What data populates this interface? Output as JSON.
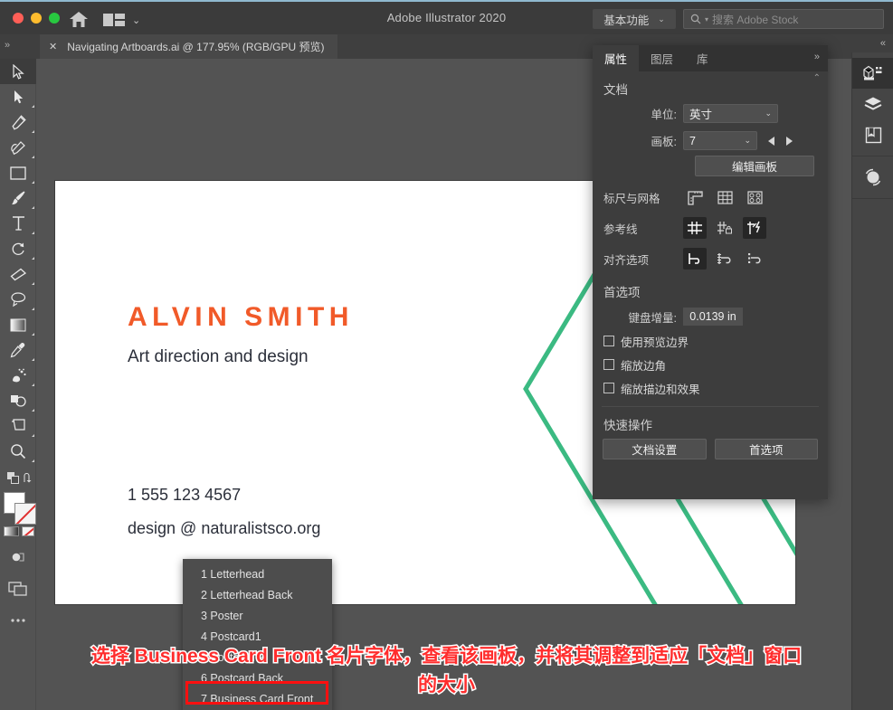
{
  "window": {
    "app_title": "Adobe Illustrator 2020",
    "traffic_lights": [
      "close",
      "minimize",
      "maximize"
    ],
    "home_icon": "home-icon",
    "workspace_switch_icon": "layout-switch-icon",
    "workspace_menu": {
      "label": "基本功能",
      "caret": "⌄"
    },
    "stock_search": {
      "placeholder": "搜索 Adobe Stock",
      "icon": "search-icon"
    }
  },
  "tabbar": {
    "overflow_left": "»",
    "overflow_right": "«",
    "tab": {
      "close": "✕",
      "title": "Navigating Artboards.ai @ 177.95% (RGB/GPU 预览)"
    }
  },
  "toolbar": {
    "tools": [
      {
        "name": "selection-tool",
        "active": true,
        "has_flyout": false
      },
      {
        "name": "direct-selection-tool",
        "active": false,
        "has_flyout": true
      },
      {
        "name": "pen-tool",
        "active": false,
        "has_flyout": true
      },
      {
        "name": "curvature-tool",
        "active": false,
        "has_flyout": true
      },
      {
        "name": "rectangle-tool",
        "active": false,
        "has_flyout": true
      },
      {
        "name": "paintbrush-tool",
        "active": false,
        "has_flyout": true
      },
      {
        "name": "type-tool",
        "active": false,
        "has_flyout": true
      },
      {
        "name": "rotate-tool",
        "active": false,
        "has_flyout": true
      },
      {
        "name": "eraser-tool",
        "active": false,
        "has_flyout": true
      },
      {
        "name": "lasso-tool",
        "active": false,
        "has_flyout": true
      },
      {
        "name": "gradient-tool",
        "active": false,
        "has_flyout": true
      },
      {
        "name": "eyedropper-tool",
        "active": false,
        "has_flyout": true
      },
      {
        "name": "symbol-sprayer-tool",
        "active": false,
        "has_flyout": true
      },
      {
        "name": "shape-builder-tool",
        "active": false,
        "has_flyout": true
      },
      {
        "name": "artboard-tool",
        "active": false,
        "has_flyout": true
      },
      {
        "name": "zoom-tool",
        "active": false,
        "has_flyout": true
      }
    ],
    "swap_fill_stroke_icon": "swap-fill-stroke-icon",
    "default_fill_stroke_icon": "default-fill-stroke-icon",
    "fill_color": "#ffffff",
    "stroke_color": "none",
    "color_mode_icons": [
      "gradient-icon",
      "none-icon"
    ],
    "draw_mode_icon": "draw-normal-icon",
    "screen_mode_icon": "screen-mode-icon",
    "more_tools_icon": "more-tools-icon"
  },
  "artwork": {
    "name": "ALVIN SMITH",
    "name_color": "#f15a29",
    "subtitle": "Art direction and design",
    "phone": "1 555 123 4567",
    "email": "design @ naturalistsco.org",
    "accent_green": "#3bba82",
    "chevron_count": 3
  },
  "artboard_dropdown": {
    "items": [
      {
        "index": 1,
        "label": "1 Letterhead",
        "selected": false
      },
      {
        "index": 2,
        "label": "2 Letterhead Back",
        "selected": false
      },
      {
        "index": 3,
        "label": "3 Poster",
        "selected": false
      },
      {
        "index": 4,
        "label": "4 Postcard1",
        "selected": false
      },
      {
        "index": 5,
        "label": "5 Postcard 2",
        "selected": false
      },
      {
        "index": 6,
        "label": "6 Postcard Back",
        "selected": false
      },
      {
        "index": 7,
        "label": "7 Business Card Front",
        "selected": true
      }
    ]
  },
  "properties": {
    "tabs": [
      {
        "label": "属性",
        "active": true
      },
      {
        "label": "图层",
        "active": false
      },
      {
        "label": "库",
        "active": false
      }
    ],
    "more_icon": "»",
    "collapse_icon": "⌃",
    "document": {
      "title": "文档",
      "units": {
        "label": "单位:",
        "value": "英寸",
        "caret": "⌄"
      },
      "artboard": {
        "label": "画板:",
        "value": "7",
        "caret": "⌄",
        "prev_icon": "prev-artboard-icon",
        "next_icon": "next-artboard-icon"
      },
      "edit_artboards_button": "编辑画板"
    },
    "rulers_grid": {
      "label": "标尺与网格",
      "icons": [
        "show-rulers-icon",
        "show-grid-icon",
        "show-transparency-grid-icon"
      ]
    },
    "guides": {
      "label": "参考线",
      "icons": [
        "show-guides-icon",
        "lock-guides-icon",
        "smart-guides-icon"
      ],
      "active_index": [
        0,
        2
      ]
    },
    "snap_options": {
      "label": "对齐选项",
      "icons": [
        "snap-to-point-icon",
        "snap-to-grid-icon",
        "snap-to-pixel-icon"
      ],
      "active_index": [
        0
      ]
    },
    "preferences": {
      "title": "首选项",
      "keyboard_increment": {
        "label": "键盘增量:",
        "value": "0.0139 in"
      },
      "checkboxes": [
        {
          "label": "使用预览边界",
          "checked": false
        },
        {
          "label": "缩放边角",
          "checked": false
        },
        {
          "label": "缩放描边和效果",
          "checked": false
        }
      ]
    },
    "quick_actions": {
      "title": "快速操作",
      "buttons": [
        "文档设置",
        "首选项"
      ]
    }
  },
  "dock": {
    "groups": [
      [
        {
          "name": "dock-properties-icon",
          "active": true
        },
        {
          "name": "dock-layers-icon",
          "active": false
        },
        {
          "name": "dock-libraries-icon",
          "active": false
        }
      ],
      [
        {
          "name": "dock-color-guide-icon",
          "active": false
        }
      ]
    ]
  },
  "annotation": {
    "line1": "选择 Business Card Front 名片字体，查看该画板，并将其调整到适应「文档」窗口",
    "line2": "的大小",
    "color": "#ff2d2d"
  }
}
